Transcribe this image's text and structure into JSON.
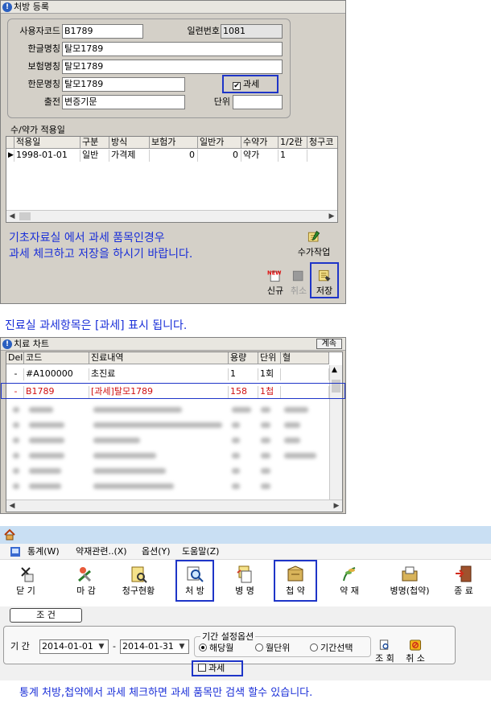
{
  "rx_window": {
    "title": "처방 등록",
    "fields": {
      "user_code_label": "사용자코드",
      "user_code_value": "B1789",
      "serial_label": "일련번호",
      "serial_value": "1081",
      "korean_name_label": "한글명칭",
      "korean_name_value": "탈모1789",
      "insurance_name_label": "보험명칭",
      "insurance_name_value": "탈모1789",
      "hanja_name_label": "한문명칭",
      "hanja_name_value": "탈모1789",
      "taxable_label": "과세",
      "source_label": "출전",
      "source_value": "변증기문",
      "unit_label": "단위",
      "unit_value": ""
    },
    "price_section": {
      "title": "수/약가 적용일",
      "columns": [
        "적용일",
        "구분",
        "방식",
        "보험가",
        "일반가",
        "수약가",
        "1/2란",
        "청구코"
      ],
      "rows": [
        [
          "1998-01-01",
          "일반",
          "가격제",
          "0",
          "0",
          "약가",
          "1",
          ""
        ]
      ]
    },
    "note_line1": "기초자료실 에서 과세 품목인경우",
    "note_line2": "과세 체크하고 저장을 하시기 바랍니다.",
    "price_work_label": "수가작업",
    "new_label": "신규",
    "new_badge": "NEW",
    "cancel_label": "취소",
    "save_label": "저장"
  },
  "caption_middle": "진료실 과세항목은 [과세] 표시 됩니다.",
  "chart_window": {
    "title": "치료 차트",
    "continue_label": "계속",
    "columns": [
      "Del",
      "코드",
      "진료내역",
      "용량",
      "단위",
      "혈"
    ],
    "rows": [
      {
        "del": "-",
        "code": "#A100000",
        "desc": "초진료",
        "qty": "1",
        "unit": "1회",
        "hyeol": ""
      },
      {
        "del": "-",
        "code": "B1789",
        "desc": "[과세]탈모1789",
        "qty": "158",
        "unit": "1첩",
        "hyeol": ""
      }
    ]
  },
  "stats_window": {
    "menu": [
      "통계(W)",
      "약재관련..(X)",
      "옵션(Y)",
      "도움말(Z)"
    ],
    "toolbar": [
      "닫 기",
      "마 감",
      "청구현황",
      "처 방",
      "병 명",
      "첩 약",
      "약 재",
      "병명(첩약)",
      "종 료"
    ],
    "condition_label": "조  건",
    "period_option_label": "기간 설정옵션",
    "period_label": "기 간",
    "date_from": "2014-01-01",
    "date_to": "2014-01-31",
    "range_sep": "-",
    "radio_options": [
      "해당월",
      "월단위",
      "기간선택"
    ],
    "taxable_label": "과세",
    "search_label": "조 회",
    "cancel_label": "취 소"
  },
  "caption_bottom": "통계 처방,첩약에서 과세 체크하면  과세 품목만  검색 할수 있습니다.",
  "colors": {
    "note_blue": "#1a2fd8",
    "highlight_border": "#1e35c8",
    "red_row": "#d01010"
  }
}
